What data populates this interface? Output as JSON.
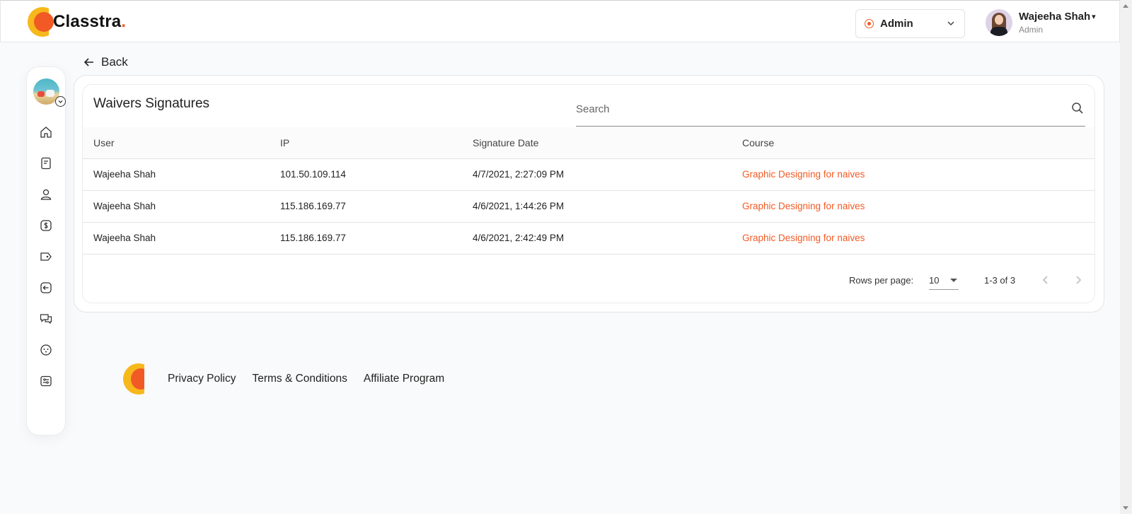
{
  "app": {
    "brand": "Classtra",
    "brand_dot": ".",
    "accent_color": "#f15a24",
    "brand_yellow": "#f6b81b"
  },
  "header": {
    "role_selector": {
      "value": "Admin"
    },
    "user": {
      "name": "Wajeeha Shah",
      "role": "Admin",
      "caret": "▾"
    }
  },
  "sidebar": {
    "items": [
      {
        "icon": "home-icon"
      },
      {
        "icon": "book-icon"
      },
      {
        "icon": "users-icon"
      },
      {
        "icon": "dollar-icon"
      },
      {
        "icon": "tag-icon"
      },
      {
        "icon": "logout-arrow-icon"
      },
      {
        "icon": "chat-icon"
      },
      {
        "icon": "palette-icon"
      },
      {
        "icon": "settings-sliders-icon"
      }
    ]
  },
  "nav": {
    "back_label": "Back"
  },
  "card": {
    "title": "Waivers Signatures",
    "search": {
      "placeholder": "Search",
      "value": ""
    },
    "columns": [
      "User",
      "IP",
      "Signature Date",
      "Course"
    ],
    "rows": [
      {
        "user": "Wajeeha Shah",
        "ip": "101.50.109.114",
        "date": "4/7/2021, 2:27:09 PM",
        "course": "Graphic Designing for naives"
      },
      {
        "user": "Wajeeha Shah",
        "ip": "115.186.169.77",
        "date": "4/6/2021, 1:44:26 PM",
        "course": "Graphic Designing for naives"
      },
      {
        "user": "Wajeeha Shah",
        "ip": "115.186.169.77",
        "date": "4/6/2021, 2:42:49 PM",
        "course": "Graphic Designing for naives"
      }
    ],
    "pagination": {
      "rows_per_page_label": "Rows per page:",
      "rows_per_page": "10",
      "range": "1-3 of 3"
    }
  },
  "footer": {
    "links": [
      "Privacy Policy",
      "Terms & Conditions",
      "Affiliate Program"
    ]
  }
}
